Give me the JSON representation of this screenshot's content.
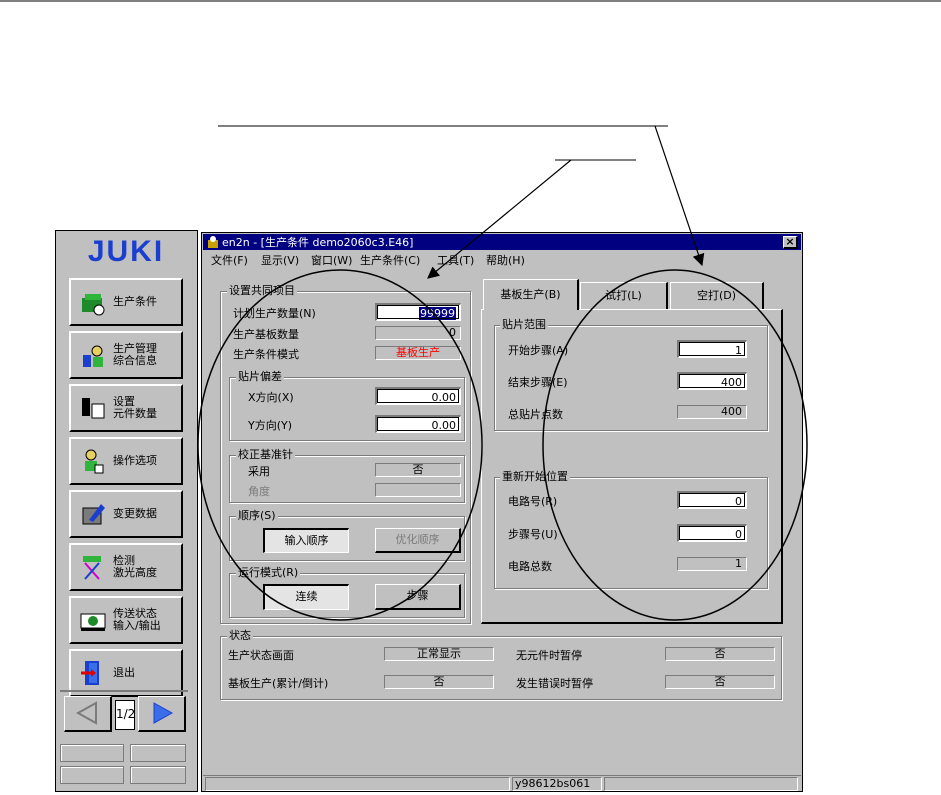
{
  "window": {
    "title": "en2n - [生产条件 demo2060c3.E46]",
    "close_glyph": "×",
    "status_text": "y98612bs061"
  },
  "menu": [
    {
      "label": "文件(F)"
    },
    {
      "label": "显示(V)"
    },
    {
      "label": "窗口(W)"
    },
    {
      "label": "生产条件(C)"
    },
    {
      "label": "工具(T)"
    },
    {
      "label": "帮助(H)"
    }
  ],
  "sidebar": {
    "logo": "JUKI",
    "buttons": [
      {
        "label": "生产条件",
        "icon": "production-condition-icon"
      },
      {
        "label": "生产管理\n综合信息",
        "icon": "production-management-icon"
      },
      {
        "label": "设置\n元件数量",
        "icon": "component-count-icon"
      },
      {
        "label": "操作选项",
        "icon": "operation-options-icon"
      },
      {
        "label": "变更数据",
        "icon": "change-data-icon"
      },
      {
        "label": "检测\n激光高度",
        "icon": "laser-height-icon"
      },
      {
        "label": "传送状态\n输入/输出",
        "icon": "transfer-status-icon"
      },
      {
        "label": "退出",
        "icon": "exit-icon"
      }
    ],
    "page_indicator": "1/2",
    "prev_icon": "left-arrow-icon",
    "next_icon": "right-arrow-icon"
  },
  "common": {
    "title": "设置共同项目",
    "plan_label": "计划生产数量(N)",
    "plan_value": "99999",
    "boards_label": "生产基板数量",
    "boards_value": "0",
    "mode_label": "生产条件模式",
    "mode_value": "基板生产",
    "offset": {
      "title": "贴片偏差",
      "x_label": "X方向(X)",
      "x_value": "0.00",
      "y_label": "Y方向(Y)",
      "y_value": "0.00"
    },
    "pin": {
      "title": "校正基准针",
      "use_label": "采用",
      "use_value": "否",
      "angle_label": "角度",
      "angle_value": ""
    },
    "order": {
      "title": "顺序(S)",
      "input_label": "输入顺序",
      "optimize_label": "优化顺序"
    },
    "run": {
      "title": "运行模式(R)",
      "continuous_label": "连续",
      "step_label": "步骤"
    }
  },
  "tabs": [
    {
      "label": "基板生产(B)"
    },
    {
      "label": "试打(L)"
    },
    {
      "label": "空打(D)"
    }
  ],
  "mount_range": {
    "title": "贴片范围",
    "start_label": "开始步骤(A)",
    "start_value": "1",
    "end_label": "结束步骤(E)",
    "end_value": "400",
    "total_label": "总贴片点数",
    "total_value": "400"
  },
  "restart": {
    "title": "重新开始位置",
    "circuit_label": "电路号(R)",
    "circuit_value": "0",
    "step_label": "步骤号(U)",
    "step_value": "0",
    "total_label": "电路总数",
    "total_value": "1"
  },
  "status": {
    "title": "状态",
    "screen_label": "生产状态画面",
    "screen_value": "正常显示",
    "nopart_label": "无元件时暂停",
    "nopart_value": "否",
    "board_label": "基板生产(累计/倒计)",
    "board_value": "否",
    "error_label": "发生错误时暂停",
    "error_value": "否"
  },
  "colors": {
    "window_bg": "#c0c0c0",
    "titlebar": "#000080",
    "mode_value": "#ff0000",
    "selected_field_bg": "#000080",
    "logo_blue": "#1a3fd0"
  }
}
